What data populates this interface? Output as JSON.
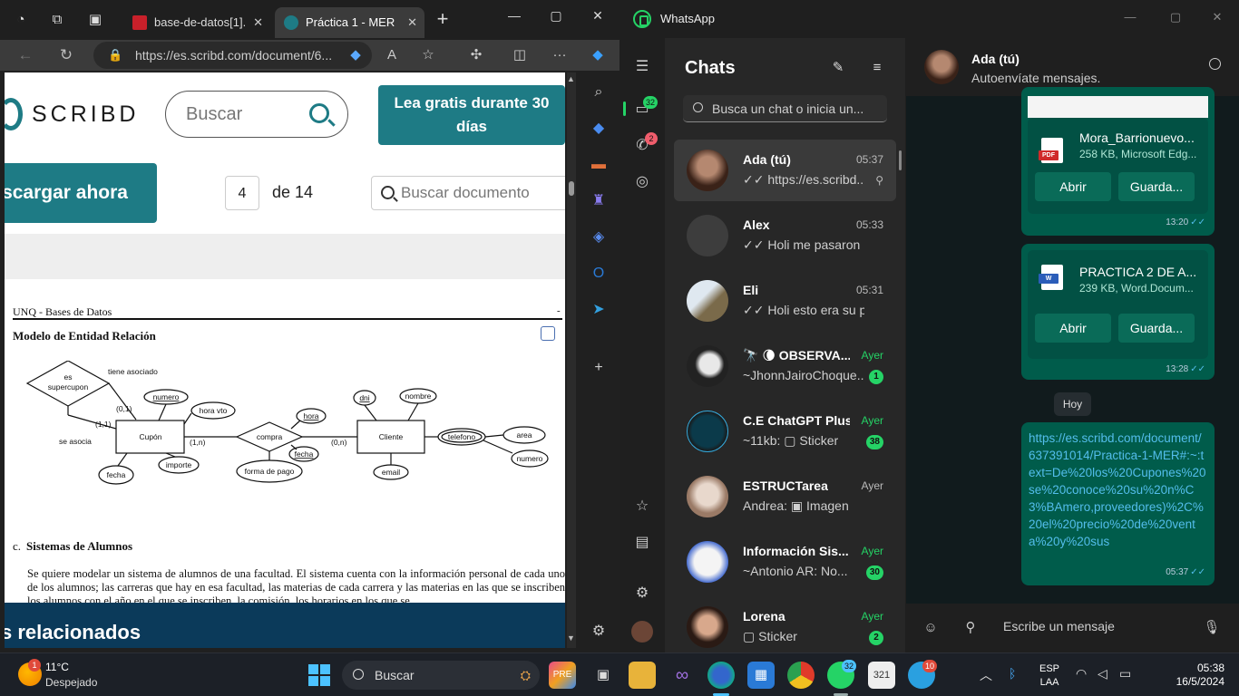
{
  "browser": {
    "tabs": [
      {
        "title": "base-de-datos[1].p",
        "favicon": "pdf"
      },
      {
        "title": "Práctica 1 - MER | P",
        "favicon": "scribd"
      }
    ],
    "address": "https://es.scribd.com/document/6...",
    "page": {
      "logo": "SCRIBD",
      "search_placeholder": "Buscar",
      "cta": "Lea gratis durante 30 días",
      "download": "scargar ahora",
      "page_number": "4",
      "page_of": "de 14",
      "doc_search_placeholder": "Buscar documento",
      "doc": {
        "header": "UNQ - Bases de Datos",
        "dash": "-",
        "title": "Modelo de Entidad Relación",
        "erd_labels": {
          "supercupon": "es\nsupercupon",
          "tiene": "tiene asociado",
          "se_asocia": "se asocia",
          "c01": "(0,1)",
          "c11": "(1,1)",
          "cupon": "Cupón",
          "numero": "numero",
          "hora_vto": "hora vto",
          "importe": "importe",
          "fecha": "fecha",
          "c1n": "(1,n)",
          "compra": "compra",
          "hora": "hora",
          "fecha2": "fecha",
          "forma": "forma de pago",
          "c0n": "(0,n)",
          "cliente": "Cliente",
          "dni": "dni",
          "nombre": "nombre",
          "email": "email",
          "telefono": "telefono",
          "area": "area",
          "numero2": "numero"
        },
        "section_letter": "c.",
        "section_title": "Sistemas de Alumnos",
        "paragraph": "Se quiere modelar un sistema de alumnos de una facultad. El sistema cuenta con la información personal de cada uno de los alumnos; las carreras que hay en esa facultad, las materias de cada carrera y las materias en las que se inscriben los alumnos con el año en el que se inscriben, la comisión, los horarios en los que se"
      },
      "related": "s relacionados"
    }
  },
  "whatsapp": {
    "app_name": "WhatsApp",
    "rail_badges": {
      "chats": "32",
      "calls": "2"
    },
    "list_title": "Chats",
    "search_placeholder": "Busca un chat o inicia un...",
    "chats": [
      {
        "name": "Ada (tú)",
        "time": "05:37",
        "preview": "✓✓ https://es.scribd....",
        "unread": "",
        "pinned": true,
        "time_green": false
      },
      {
        "name": "Alex",
        "time": "05:33",
        "preview": "✓✓ Holi me pasaron",
        "unread": "",
        "pinned": false,
        "time_green": false
      },
      {
        "name": "Eli",
        "time": "05:31",
        "preview": "✓✓ Holi esto era su p...",
        "unread": "",
        "pinned": false,
        "time_green": false
      },
      {
        "name": "🔭 🌘 OBSERVA...",
        "time": "Ayer",
        "preview": "~JhonnJairoChoque...",
        "unread": "1",
        "pinned": false,
        "time_green": true
      },
      {
        "name": "C.E ChatGPT Plus",
        "time": "Ayer",
        "preview": "~11kb: ▢ Sticker",
        "unread": "38",
        "pinned": false,
        "time_green": true
      },
      {
        "name": "ESTRUCTarea",
        "time": "Ayer",
        "preview": "Andrea: ▣ Imagen",
        "unread": "",
        "pinned": false,
        "time_green": false
      },
      {
        "name": "Información Sis...",
        "time": "Ayer",
        "preview": "~Antonio AR: No...",
        "unread": "30",
        "pinned": false,
        "time_green": true
      },
      {
        "name": "Lorena",
        "time": "Ayer",
        "preview": "▢ Sticker",
        "unread": "2",
        "pinned": false,
        "time_green": true
      }
    ],
    "chat": {
      "name": "Ada (tú)",
      "subtitle": "Autoenvíate mensajes.",
      "messages": [
        {
          "file": "Mora_Barrionuevo...",
          "meta": "258 KB, Microsoft Edg...",
          "tag": "PDF",
          "open": "Abrir",
          "save": "Guarda...",
          "time": "13:20"
        },
        {
          "file": "PRACTICA 2 DE A...",
          "meta": "239 KB, Word.Docum...",
          "tag": "W",
          "open": "Abrir",
          "save": "Guarda...",
          "time": "13:28"
        }
      ],
      "day": "Hoy",
      "link": "https://es.scribd.com/document/637391014/Practica-1-MER#:~:text=De%20los%20Cupones%20se%20conoce%20su%20n%C3%BAmero,proveedores)%2C%20el%20precio%20de%20venta%20y%20sus",
      "link_time": "05:37",
      "composer_placeholder": "Escribe un mensaje"
    }
  },
  "taskbar": {
    "weather_badge": "1",
    "temp": "11°C",
    "condition": "Despejado",
    "search": "Buscar",
    "whatsapp_badge": "32",
    "telegram_badge": "10",
    "lang1": "ESP",
    "lang2": "LAA",
    "time": "05:38",
    "date": "16/5/2024"
  },
  "colors": {
    "scribd_teal": "#1e7b85",
    "wa_green": "#25d366",
    "bubble": "#005c4b"
  }
}
